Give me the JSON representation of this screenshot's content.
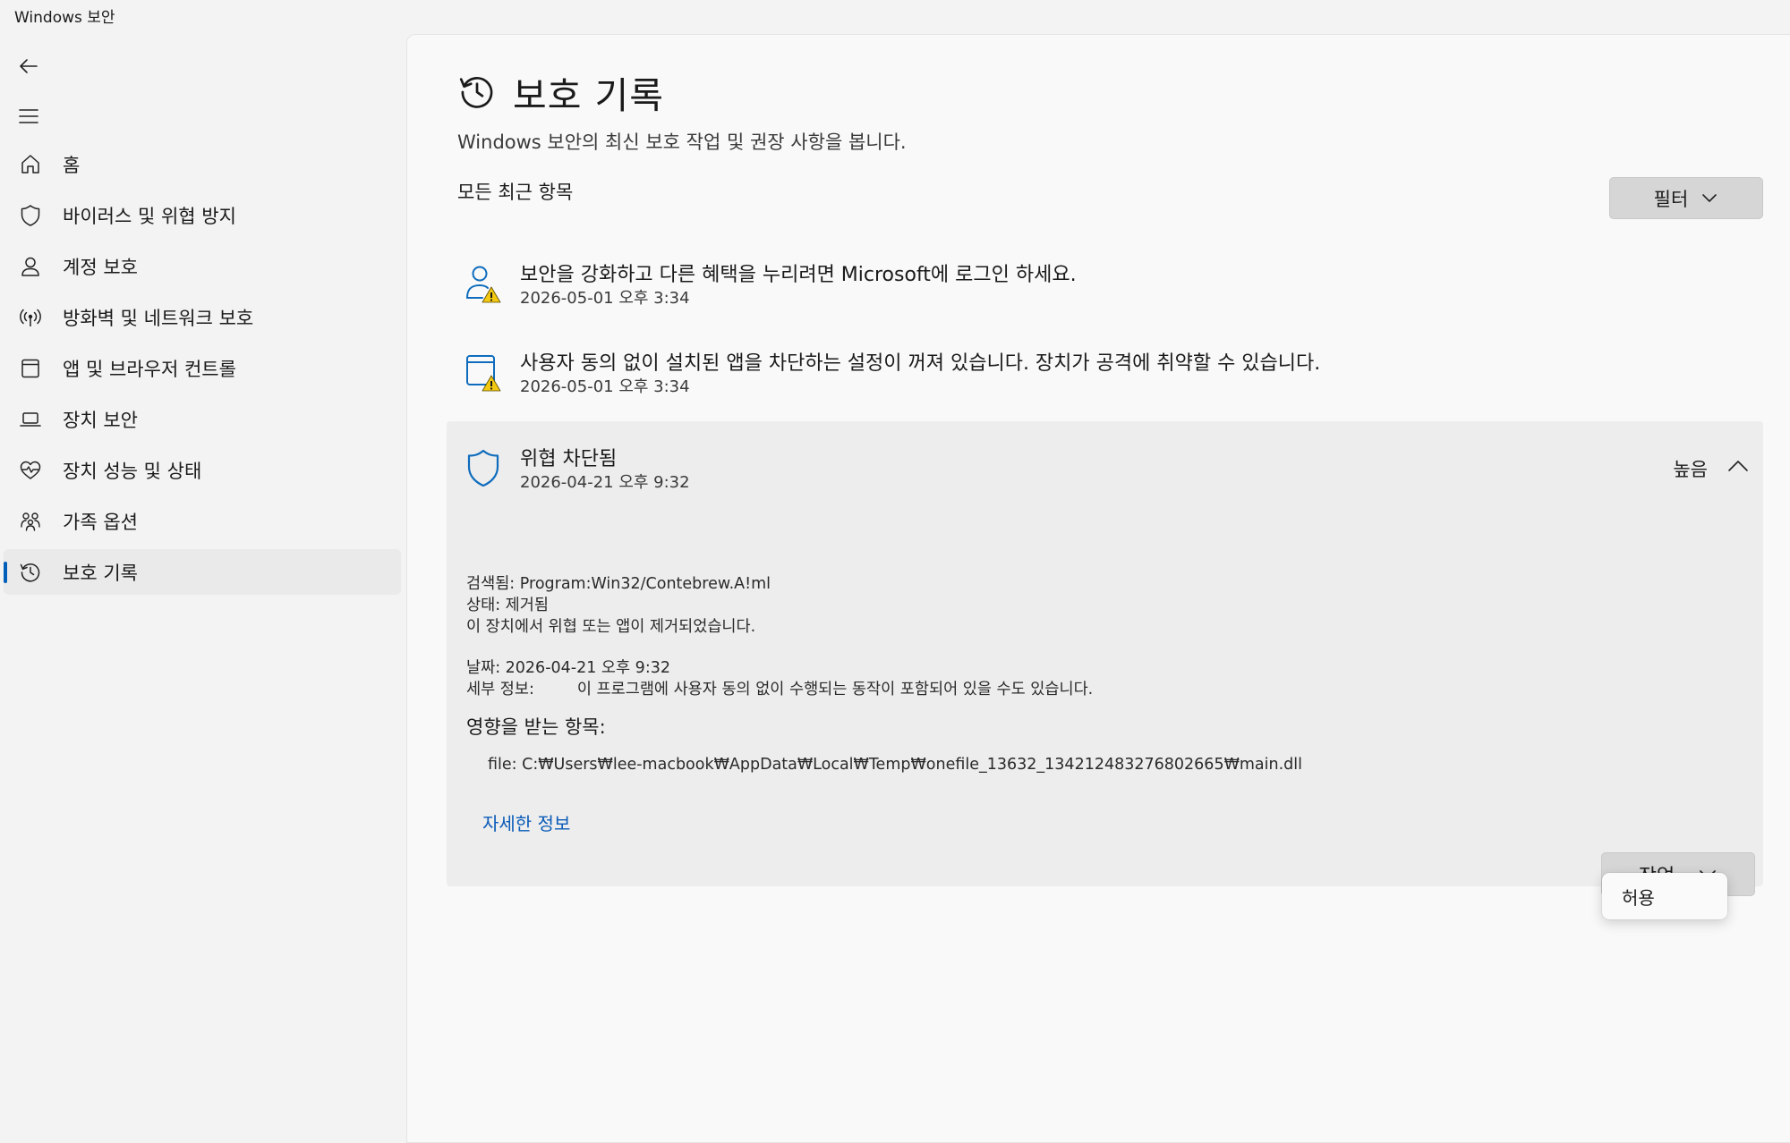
{
  "app": {
    "title": "Windows 보안"
  },
  "sidebar": {
    "items": [
      {
        "label": "홈",
        "icon": "home-icon"
      },
      {
        "label": "바이러스 및 위협 방지",
        "icon": "shield-icon"
      },
      {
        "label": "계정 보호",
        "icon": "person-icon"
      },
      {
        "label": "방화벽 및 네트워크 보호",
        "icon": "antenna-icon"
      },
      {
        "label": "앱 및 브라우저 컨트롤",
        "icon": "app-window-icon"
      },
      {
        "label": "장치 보안",
        "icon": "laptop-icon"
      },
      {
        "label": "장치 성능 및 상태",
        "icon": "heart-pulse-icon"
      },
      {
        "label": "가족 옵션",
        "icon": "family-icon"
      },
      {
        "label": "보호 기록",
        "icon": "history-icon",
        "selected": true
      }
    ]
  },
  "main": {
    "title": "보호 기록",
    "description": "Windows 보안의 최신 보호 작업 및 권장 사항을 봅니다.",
    "section_label": "모든 최근 항목",
    "filter_label": "필터",
    "entries": [
      {
        "title": "보안을 강화하고 다른 혜택을 누리려면 Microsoft에 로그인 하세요.",
        "time": "2026-05-01 오후 3:34",
        "icon": "account-warning-icon"
      },
      {
        "title": "사용자 동의 없이 설치된 앱을 차단하는 설정이 꺼져 있습니다. 장치가 공격에 취약할 수 있습니다.",
        "time": "2026-05-01 오후 3:34",
        "icon": "app-warning-icon"
      }
    ],
    "threat": {
      "title": "위협 차단됨",
      "time": "2026-04-21 오후 9:32",
      "severity": "높음",
      "detected": "검색됨: Program:Win32/Contebrew.A!ml",
      "status": "상태: 제거됨",
      "status_note": "이 장치에서 위협 또는 앱이 제거되었습니다.",
      "date": "날짜: 2026-04-21 오후 9:32",
      "details_label": "세부 정보:",
      "details_text": "이 프로그램에 사용자 동의 없이 수행되는 동작이 포함되어 있을 수도 있습니다.",
      "affected_label": "영향을 받는 항목:",
      "file_path": "file: C:₩Users₩lee-macbook₩AppData₩Local₩Temp₩onefile_13632_134212483276802665₩main.dll",
      "more_info": "자세한 정보",
      "action_label": "작업",
      "dropdown_option": "허용"
    }
  },
  "colors": {
    "accent": "#005fb8",
    "link": "#0a5cb8",
    "warning": "#f2c811"
  }
}
